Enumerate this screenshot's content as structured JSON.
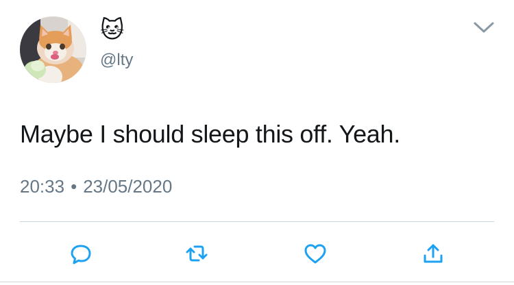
{
  "user": {
    "display_name": "🐱",
    "handle": "@lty"
  },
  "tweet": {
    "text": "Maybe I should sleep this off. Yeah.",
    "time": "20:33",
    "separator": "•",
    "date": "23/05/2020"
  },
  "actions": [
    {
      "icon": "reply-icon"
    },
    {
      "icon": "retweet-icon"
    },
    {
      "icon": "like-icon"
    },
    {
      "icon": "share-icon"
    }
  ],
  "colors": {
    "text": "#14171a",
    "secondary": "#657786",
    "divider": "#ccd6dd",
    "icon_accent": "#1da1f2"
  }
}
